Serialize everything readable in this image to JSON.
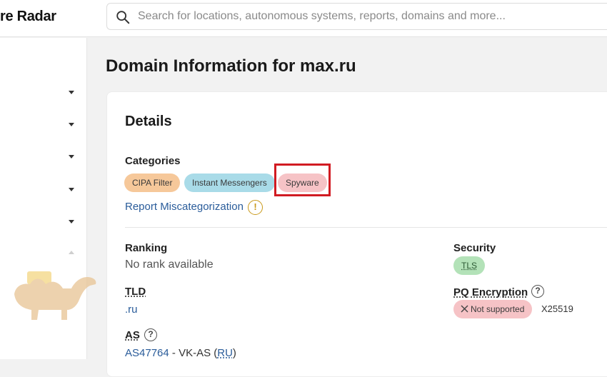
{
  "header": {
    "brand": "re Radar",
    "search_placeholder": "Search for locations, autonomous systems, reports, domains and more..."
  },
  "sidebar": {
    "collapsed_sections": 5
  },
  "page": {
    "title": "Domain Information for max.ru"
  },
  "details": {
    "heading": "Details",
    "categories_label": "Categories",
    "categories": [
      "CIPA Filter",
      "Instant Messengers",
      "Spyware"
    ],
    "highlighted_category": "Spyware",
    "report_link": "Report Miscategorization",
    "ranking_label": "Ranking",
    "ranking_value": "No rank available",
    "tld_label": "TLD",
    "tld_value": ".ru",
    "as_label": "AS",
    "as_link": "AS47764",
    "as_name": " - VK-AS (",
    "as_country": "RU",
    "as_close": ")",
    "security_label": "Security",
    "security_badge": "TLS",
    "pq_label": "PQ Encryption",
    "pq_badge": "Not supported",
    "pq_value": "X25519"
  },
  "colors": {
    "highlight_border": "#d11b22",
    "link": "#2a5c9a",
    "badge_orange": "#f6c89a",
    "badge_blue": "#a9dbe8",
    "badge_pink": "#f6c3c6",
    "badge_green": "#b3e2b8"
  }
}
